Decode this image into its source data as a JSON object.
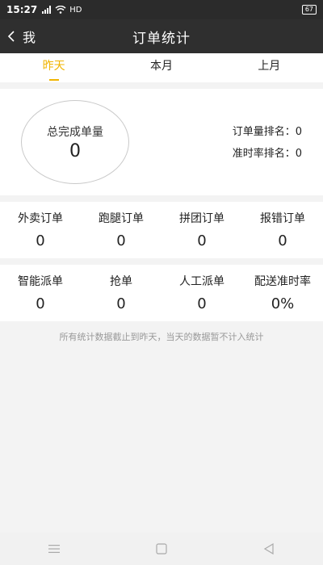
{
  "status": {
    "time": "15:27",
    "network": "HD",
    "battery": "67"
  },
  "nav": {
    "back_label": "我",
    "title": "订单统计"
  },
  "tabs": [
    {
      "label": "昨天",
      "active": true
    },
    {
      "label": "本月",
      "active": false
    },
    {
      "label": "上月",
      "active": false
    }
  ],
  "summary": {
    "total_label": "总完成单量",
    "total_value": "0",
    "order_rank_label": "订单量排名：",
    "order_rank_value": "0",
    "ontime_rank_label": "准时率排名：",
    "ontime_rank_value": "0"
  },
  "stats_row1": [
    {
      "label": "外卖订单",
      "value": "0"
    },
    {
      "label": "跑腿订单",
      "value": "0"
    },
    {
      "label": "拼团订单",
      "value": "0"
    },
    {
      "label": "报错订单",
      "value": "0"
    }
  ],
  "stats_row2": [
    {
      "label": "智能派单",
      "value": "0"
    },
    {
      "label": "抢单",
      "value": "0"
    },
    {
      "label": "人工派单",
      "value": "0"
    },
    {
      "label": "配送准时率",
      "value": "0%"
    }
  ],
  "footnote": "所有统计数据截止到昨天，当天的数据暂不计入统计",
  "colors": {
    "accent": "#f0b400",
    "header_bg": "#2f2f2f"
  }
}
